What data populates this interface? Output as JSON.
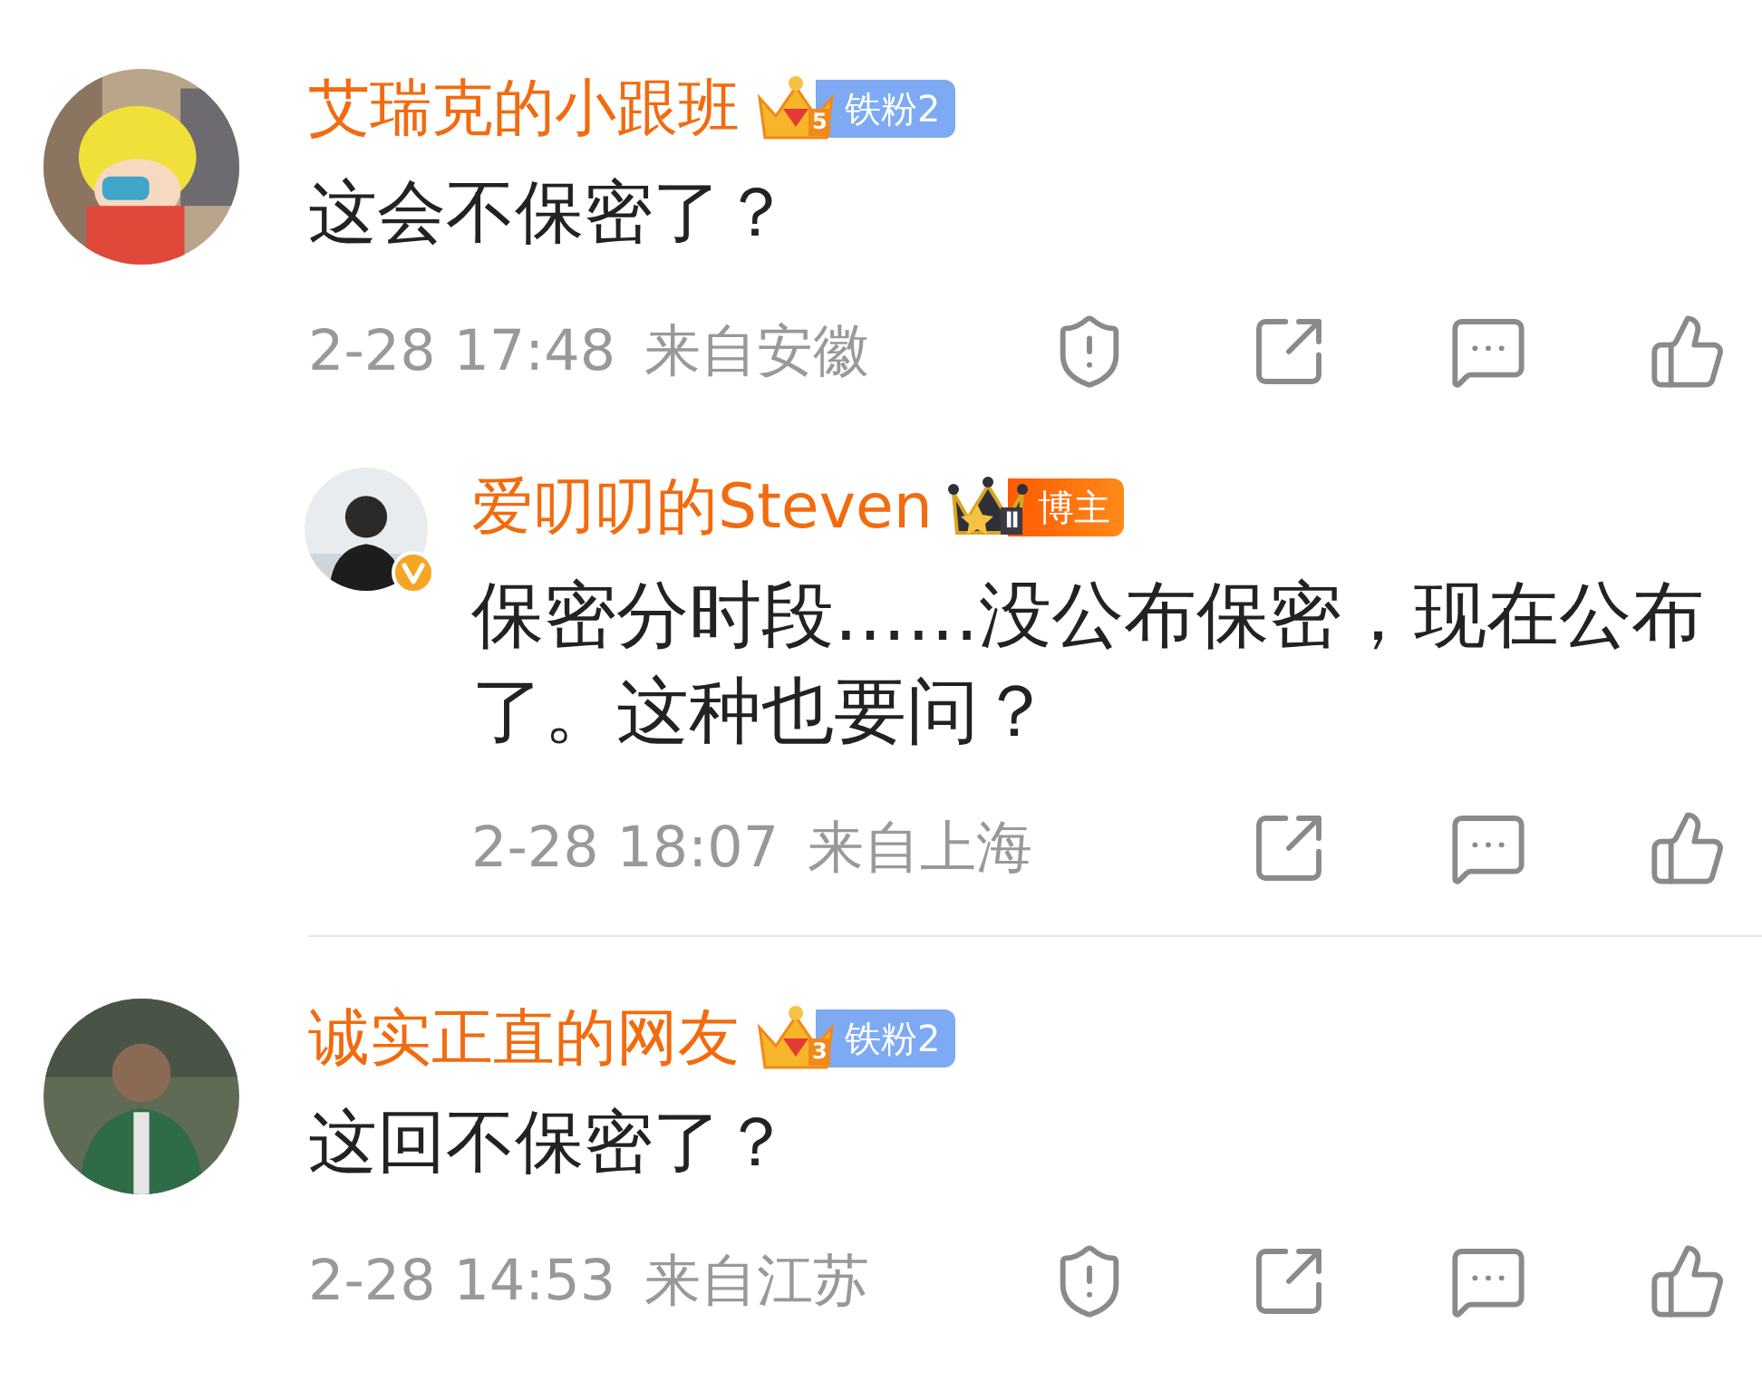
{
  "comments": [
    {
      "user": {
        "name": "艾瑞克的小跟班",
        "verified": false,
        "badge": {
          "kind": "fan",
          "rank": "5",
          "label": "铁粉2"
        }
      },
      "text": "这会不保密了？",
      "time": "2-28 17:48",
      "location": "来自安徽",
      "actions": [
        {
          "kind": "report"
        },
        {
          "kind": "share"
        },
        {
          "kind": "comment"
        },
        {
          "kind": "like"
        }
      ],
      "replies": [
        {
          "user": {
            "name": "爱叨叨的Steven",
            "verified": true,
            "badge": {
              "kind": "host",
              "rank": "Ⅱ",
              "label": "博主"
            }
          },
          "text": "保密分时段……没公布保密，现在公布了。这种也要问？",
          "time": "2-28 18:07",
          "location": "来自上海",
          "actions": [
            {
              "kind": "share"
            },
            {
              "kind": "comment"
            },
            {
              "kind": "like"
            }
          ]
        }
      ]
    },
    {
      "user": {
        "name": "诚实正直的网友",
        "verified": false,
        "badge": {
          "kind": "fan",
          "rank": "3",
          "label": "铁粉2"
        }
      },
      "text": "这回不保密了？",
      "time": "2-28 14:53",
      "location": "来自江苏",
      "actions": [
        {
          "kind": "report"
        },
        {
          "kind": "share"
        },
        {
          "kind": "comment"
        },
        {
          "kind": "like"
        }
      ]
    }
  ]
}
